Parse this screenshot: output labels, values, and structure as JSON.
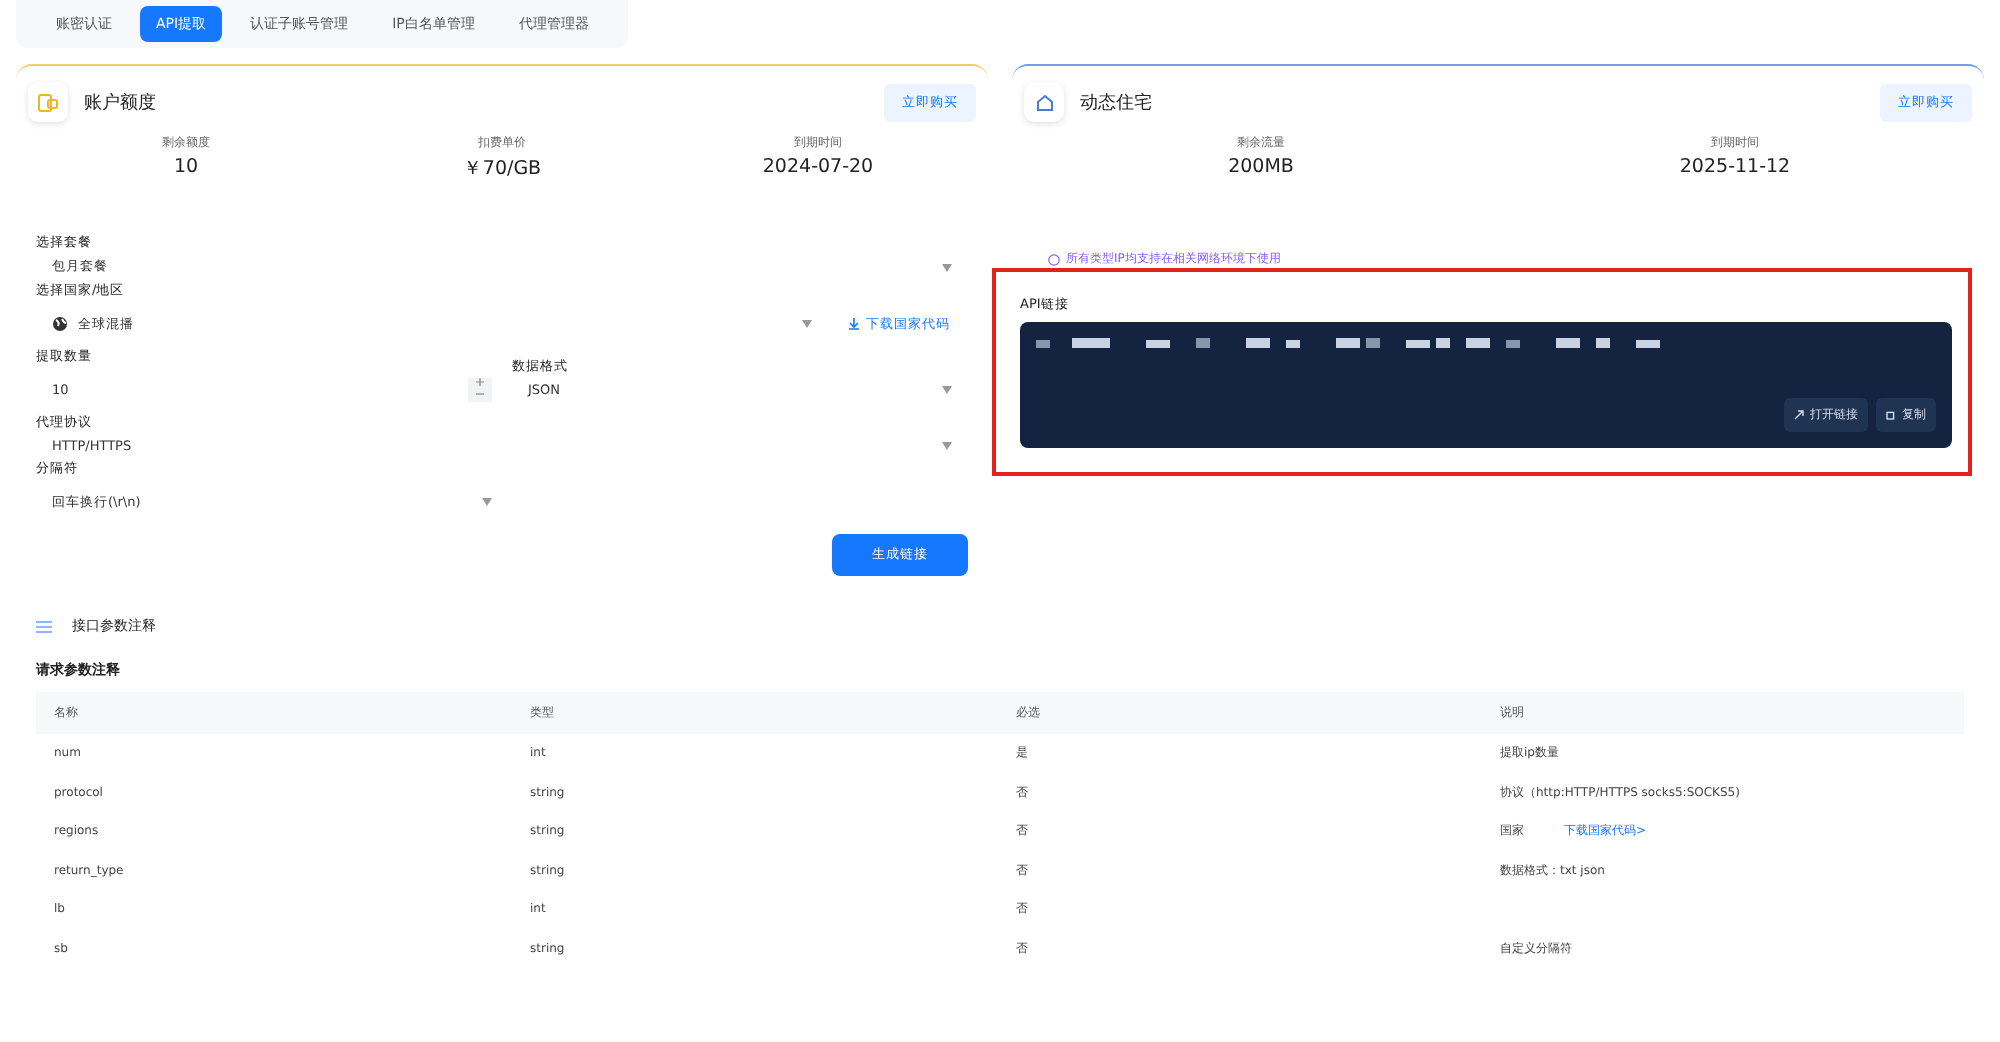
{
  "tabs": [
    {
      "label": "账密认证",
      "selected": false
    },
    {
      "label": "API提取",
      "selected": true
    },
    {
      "label": "认证子账号管理",
      "selected": false
    },
    {
      "label": "IP白名单管理",
      "selected": false
    },
    {
      "label": "代理管理器",
      "selected": false
    }
  ],
  "account_card": {
    "title": "账户额度",
    "buy_button": "立即购买",
    "stats": [
      {
        "label": "剩余额度",
        "value": "10"
      },
      {
        "label": "扣费单价",
        "value": "￥70/GB"
      },
      {
        "label": "到期时间",
        "value": "2024-07-20"
      }
    ]
  },
  "form": {
    "package": {
      "label": "选择套餐",
      "value": "包月套餐"
    },
    "region": {
      "label": "选择国家/地区",
      "value": "全球混播",
      "download_link": "下载国家代码"
    },
    "quantity": {
      "label": "提取数量",
      "value": "10"
    },
    "format": {
      "label": "数据格式",
      "value": "JSON"
    },
    "protocol": {
      "label": "代理协议",
      "value": "HTTP/HTTPS"
    },
    "separator": {
      "label": "分隔符",
      "value": "回车换行(\\r\\n)"
    },
    "generate_button": "生成链接"
  },
  "residential_card": {
    "title": "动态住宅",
    "buy_button": "立即购买",
    "stats": [
      {
        "label": "剩余流量",
        "value": "200MB"
      },
      {
        "label": "到期时间",
        "value": "2025-11-12"
      }
    ],
    "notice": "所有类型IP均支持在相关网络环境下使用",
    "api_link": {
      "label": "API链接",
      "open_button": "打开链接",
      "copy_button": "复制"
    }
  },
  "params": {
    "title": "接口参数注释",
    "subtitle": "请求参数注释",
    "columns": [
      "名称",
      "类型",
      "必选",
      "说明"
    ],
    "rows": [
      {
        "name": "num",
        "type": "int",
        "required": "是",
        "description": "提取ip数量"
      },
      {
        "name": "protocol",
        "type": "string",
        "required": "否",
        "description": "协议（http:HTTP/HTTPS socks5:SOCKS5)"
      },
      {
        "name": "regions",
        "type": "string",
        "required": "否",
        "description": "国家",
        "link": "下载国家代码>"
      },
      {
        "name": "return_type",
        "type": "string",
        "required": "否",
        "description": "数据格式：txt json"
      },
      {
        "name": "lb",
        "type": "int",
        "required": "否"
      },
      {
        "name": "sb",
        "type": "string",
        "required": "否",
        "description": "自定义分隔符"
      }
    ]
  }
}
